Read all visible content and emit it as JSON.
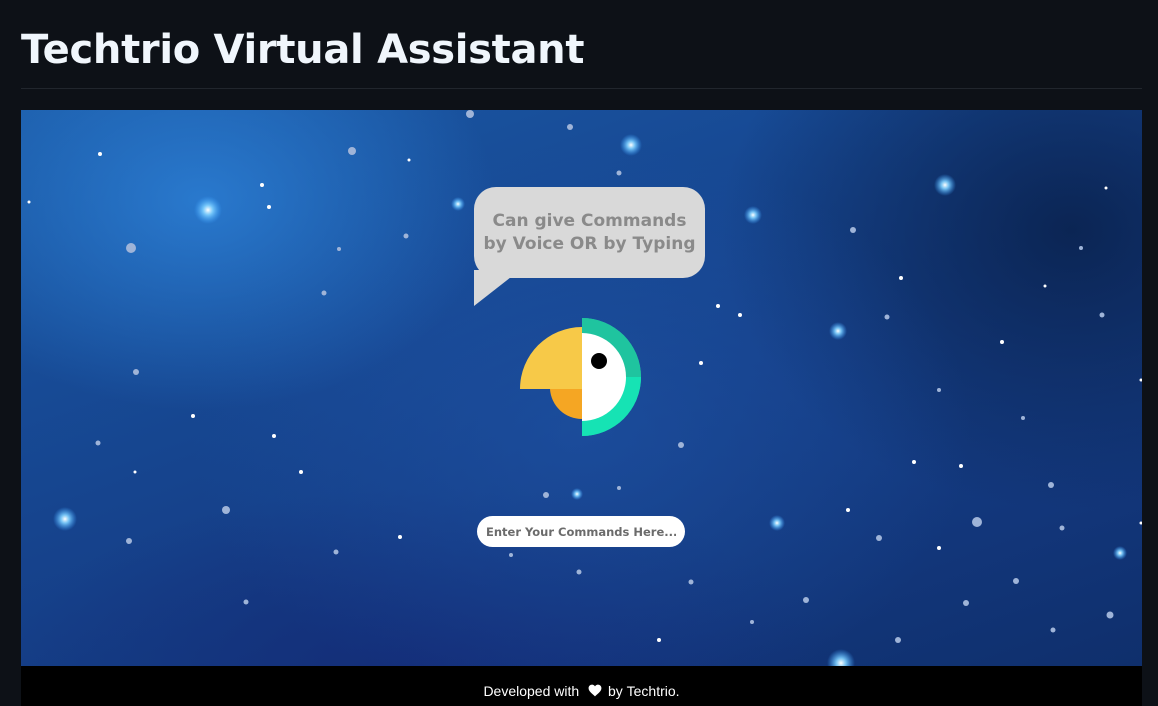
{
  "header": {
    "title": "Techtrio Virtual Assistant"
  },
  "assistant": {
    "speech_bubble": {
      "line1": "Can give Commands",
      "line2": "by Voice OR by Typing"
    },
    "mascot_icon": "parrot-icon",
    "command_input": {
      "placeholder": "Enter Your Commands Here...",
      "value": ""
    }
  },
  "footer": {
    "prefix": "Developed with",
    "heart_icon": "heart-icon",
    "middle": "by",
    "brand": "Techtrio."
  },
  "colors": {
    "page_background": "#0d1117",
    "parrot_yellow": "#f7c948",
    "parrot_orange": "#f5a623",
    "parrot_teal": "#16e3b4",
    "bubble_gray": "#d9d9d9"
  }
}
